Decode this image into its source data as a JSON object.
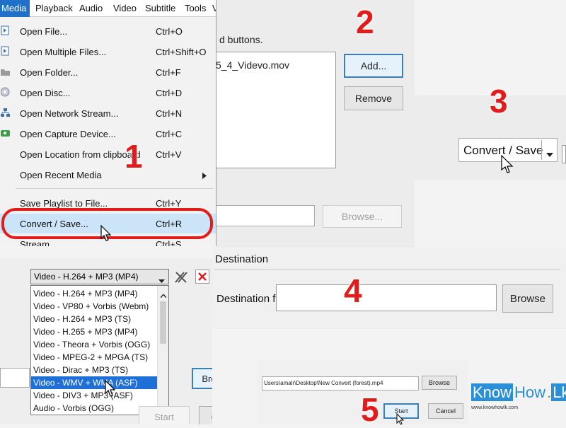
{
  "menubar": {
    "items": [
      "Media",
      "Playback",
      "Audio",
      "Video",
      "Subtitle",
      "Tools",
      "V"
    ]
  },
  "media_menu": {
    "items": [
      {
        "label": "Open File...",
        "shortcut": "Ctrl+O",
        "icon": "file-icon"
      },
      {
        "label": "Open Multiple Files...",
        "shortcut": "Ctrl+Shift+O",
        "icon": "files-icon"
      },
      {
        "label": "Open Folder...",
        "shortcut": "Ctrl+F",
        "icon": "folder-icon"
      },
      {
        "label": "Open Disc...",
        "shortcut": "Ctrl+D",
        "icon": "disc-icon"
      },
      {
        "label": "Open Network Stream...",
        "shortcut": "Ctrl+N",
        "icon": "network-icon"
      },
      {
        "label": "Open Capture Device...",
        "shortcut": "Ctrl+C",
        "icon": "capture-icon"
      },
      {
        "label": "Open Location from clipboard",
        "shortcut": "Ctrl+V",
        "icon": ""
      },
      {
        "label": "Open Recent Media",
        "shortcut": "",
        "icon": ""
      },
      {
        "label": "Save Playlist to File...",
        "shortcut": "Ctrl+Y",
        "icon": ""
      },
      {
        "label": "Convert / Save...",
        "shortcut": "Ctrl+R",
        "icon": ""
      },
      {
        "label": "Stream...",
        "shortcut": "Ctrl+S",
        "icon": ""
      }
    ]
  },
  "file_selection": {
    "hint": "d buttons.",
    "file_name": "5_4_Videvo.mov",
    "add_label": "Add...",
    "remove_label": "Remove",
    "browse_label": "Browse..."
  },
  "convert": {
    "label": "Convert / Save"
  },
  "profile": {
    "selected": "Video - H.264 + MP3 (MP4)",
    "options": [
      "Video - H.264 + MP3 (MP4)",
      "Video - VP80 + Vorbis (Webm)",
      "Video - H.264 + MP3 (TS)",
      "Video - H.265 + MP3 (MP4)",
      "Video - Theora + Vorbis (OGG)",
      "Video - MPEG-2 + MPGA (TS)",
      "Video - Dirac + MP3 (TS)",
      "Video - WMV + WMA (ASF)",
      "Video - DIV3 + MP3 (ASF)",
      "Audio - Vorbis (OGG)"
    ],
    "highlighted_index": 7,
    "browse_label": "Browse",
    "start_label": "Start",
    "cancel_label": "Cancel"
  },
  "destination": {
    "group_title": "Destination",
    "file_label": "Destination file:",
    "file_value": "",
    "browse_label": "Browse"
  },
  "final": {
    "path": "Users\\amalr\\Desktop\\New Convert (forest).mp4",
    "browse_label": "Browse",
    "start_label": "Start",
    "cancel_label": "Cancel"
  },
  "steps": [
    "1",
    "2",
    "3",
    "4",
    "5"
  ],
  "logo": {
    "know": "Know",
    "how": "How",
    "dot": ".",
    "lk": "Lk",
    "url": "www.knowhowlk.com"
  },
  "colors": {
    "annotation": "#e21b1b",
    "selection": "#1e70d8",
    "menu_highlight": "#cce4f7"
  }
}
